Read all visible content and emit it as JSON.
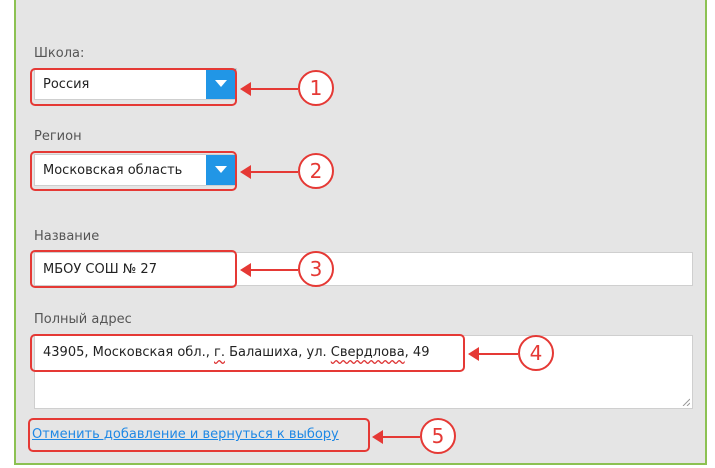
{
  "form": {
    "school": {
      "label": "Школа:",
      "value": "Россия"
    },
    "region": {
      "label": "Регион",
      "value": "Московская область"
    },
    "name": {
      "label": "Название",
      "value": "МБОУ СОШ № 27"
    },
    "address": {
      "label": "Полный адрес",
      "value_before": "43905, Московская обл., ",
      "value_typo1": "г.",
      "value_mid": " Балашиха, ул. ",
      "value_typo2": "Свердлова",
      "value_after": ", 49"
    },
    "cancel_link": "Отменить добавление и вернуться к выбору"
  },
  "callouts": [
    "1",
    "2",
    "3",
    "4",
    "5"
  ],
  "colors": {
    "accent_border": "#8cc152",
    "dropdown_button": "#2196e6",
    "highlight": "#e53935",
    "link": "#1e88e5"
  }
}
